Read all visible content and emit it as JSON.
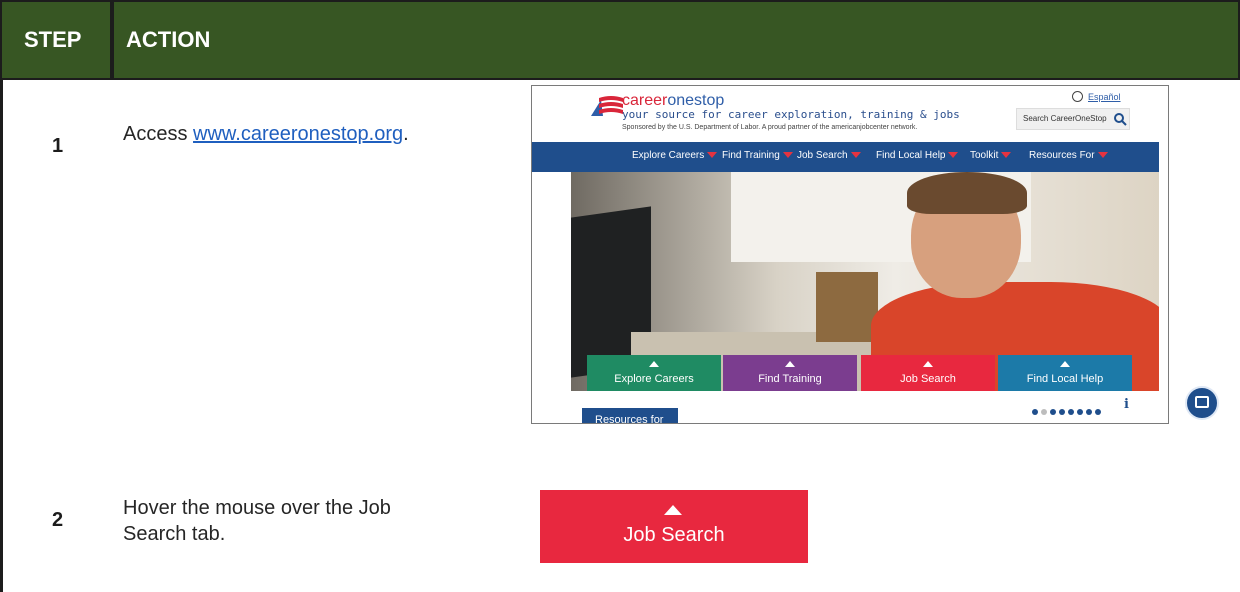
{
  "table": {
    "header_step": "STEP",
    "header_action": "ACTION"
  },
  "steps": [
    {
      "number": "1",
      "text_prefix": "Access ",
      "link_text": "www.careeronestop.org",
      "text_suffix": "."
    },
    {
      "number": "2",
      "line1": "Hover the mouse over the Job",
      "line2": "Search tab."
    }
  ],
  "screenshot1": {
    "logo_career": "career",
    "logo_onestop": "onestop",
    "tagline": "your source for career exploration, training & jobs",
    "sponsor": "Sponsored by the U.S. Department of Labor. A proud partner of the americanjobcenter network.",
    "language_link": "Español",
    "search_placeholder": "Search CareerOneStop",
    "nav": [
      "Explore Careers",
      "Find Training",
      "Job Search",
      "Find Local Help",
      "Toolkit",
      "Resources For"
    ],
    "hero_tabs": [
      {
        "label": "Explore Careers",
        "color": "#1f8b63"
      },
      {
        "label": "Find Training",
        "color": "#7b3d8f"
      },
      {
        "label": "Job Search",
        "color": "#e8283f"
      },
      {
        "label": "Find Local Help",
        "color": "#1c7aa8"
      }
    ],
    "info_icon": "i",
    "resources_label": "Resources for"
  },
  "screenshot2": {
    "label": "Job Search"
  }
}
